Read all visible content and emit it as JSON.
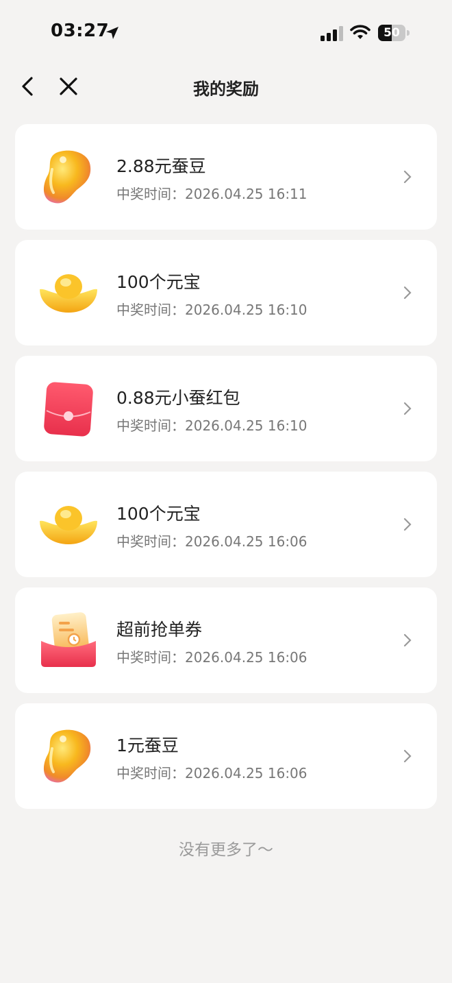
{
  "status_bar": {
    "time": "03:27",
    "battery_text": "50",
    "battery_level": 0.5
  },
  "nav": {
    "title": "我的奖励"
  },
  "rewards": [
    {
      "name": "2.88元蚕豆",
      "time_label": "中奖时间：",
      "time": "2026.04.25 16:11",
      "icon": "bean-icon"
    },
    {
      "name": "100个元宝",
      "time_label": "中奖时间：",
      "time": "2026.04.25 16:10",
      "icon": "gold-ingot-icon"
    },
    {
      "name": "0.88元小蚕红包",
      "time_label": "中奖时间：",
      "time": "2026.04.25 16:10",
      "icon": "red-envelope-icon"
    },
    {
      "name": "100个元宝",
      "time_label": "中奖时间：",
      "time": "2026.04.25 16:06",
      "icon": "gold-ingot-icon"
    },
    {
      "name": "超前抢单券",
      "time_label": "中奖时间：",
      "time": "2026.04.25 16:06",
      "icon": "coupon-icon"
    },
    {
      "name": "1元蚕豆",
      "time_label": "中奖时间：",
      "time": "2026.04.25 16:06",
      "icon": "bean-icon"
    }
  ],
  "footer": "没有更多了～",
  "colors": {
    "background": "#f4f3f2",
    "card": "#ffffff",
    "gold": "#f7b51b",
    "red": "#f5405a"
  }
}
